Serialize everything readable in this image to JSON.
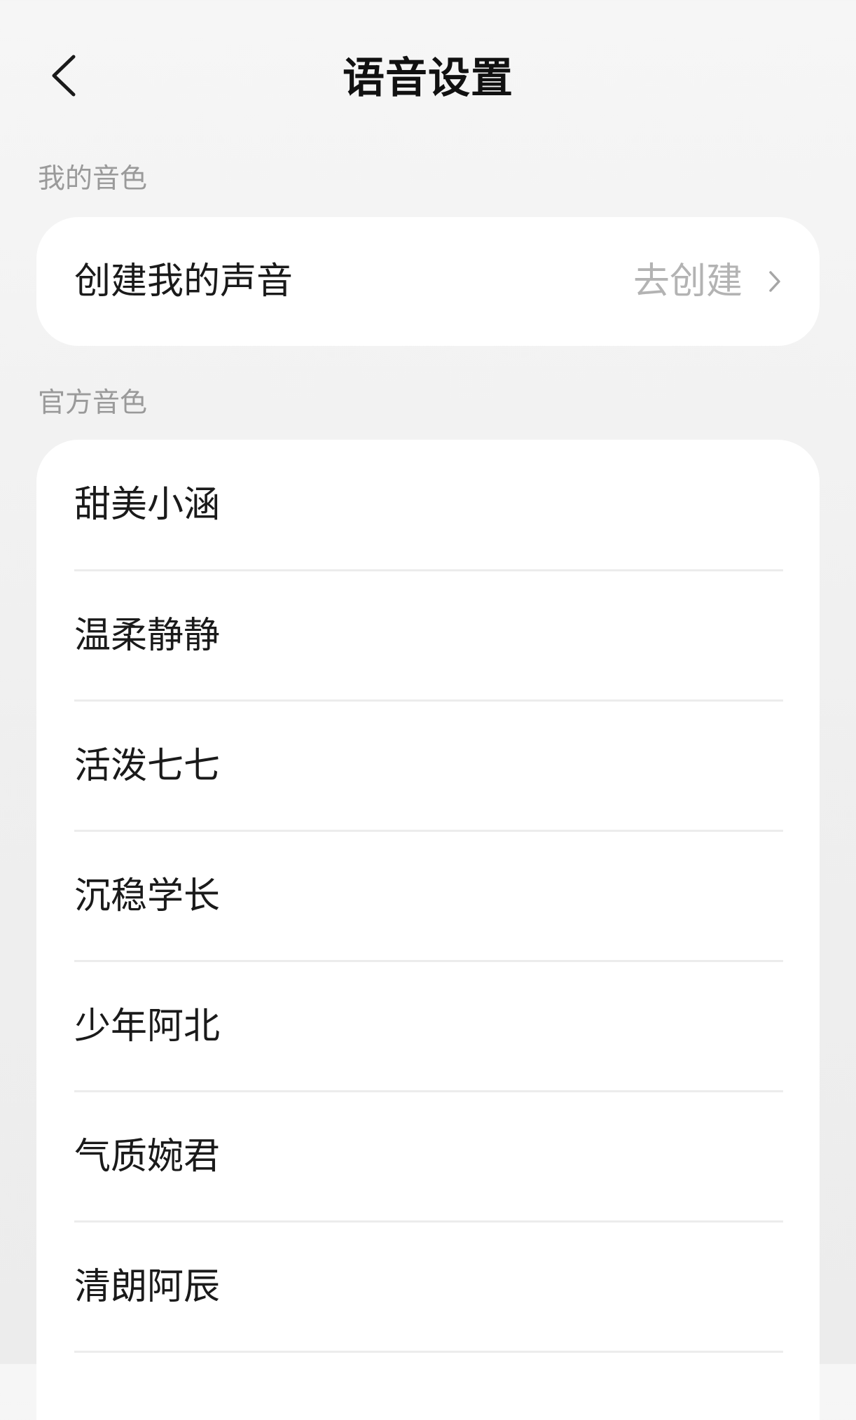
{
  "header": {
    "title": "语音设置",
    "back_icon": "chevron-left-icon"
  },
  "my_voice_section": {
    "label": "我的音色",
    "create_item": {
      "label": "创建我的声音",
      "action_text": "去创建",
      "action_icon": "chevron-right-icon"
    }
  },
  "official_voice_section": {
    "label": "官方音色",
    "items": [
      {
        "label": "甜美小涵"
      },
      {
        "label": "温柔静静"
      },
      {
        "label": "活泼七七"
      },
      {
        "label": "沉稳学长"
      },
      {
        "label": "少年阿北"
      },
      {
        "label": "气质婉君"
      },
      {
        "label": "清朗阿辰"
      }
    ]
  },
  "colors": {
    "background": "#f2f2f2",
    "card": "#ffffff",
    "primary_text": "#1a1a1a",
    "secondary_text": "#9a9a9a",
    "action_text": "#b3b3b3",
    "divider": "#ececec"
  }
}
